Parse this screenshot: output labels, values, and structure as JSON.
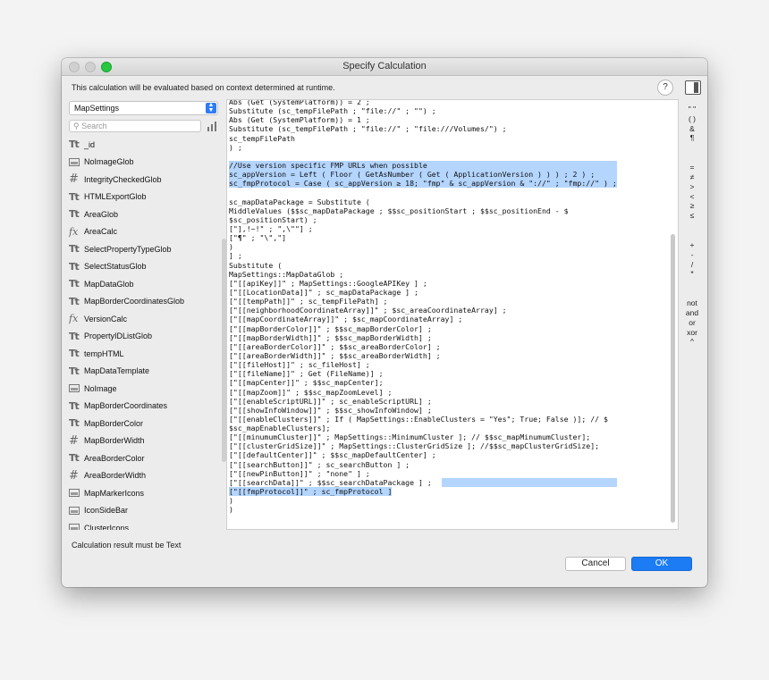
{
  "window": {
    "title": "Specify Calculation",
    "notice": "This calculation will be evaluated based on context determined at runtime.",
    "help_label": "?"
  },
  "left": {
    "table_select": "MapSettings",
    "search_placeholder": "Search",
    "fields": [
      {
        "icon": "text-icon",
        "glyph": "Tt",
        "name": "_id"
      },
      {
        "icon": "container-icon",
        "glyph": "",
        "name": "NoImageGlob"
      },
      {
        "icon": "number-icon",
        "glyph": "#",
        "name": "IntegrityCheckedGlob"
      },
      {
        "icon": "text-icon",
        "glyph": "Tt",
        "name": "HTMLExportGlob"
      },
      {
        "icon": "text-icon",
        "glyph": "Tt",
        "name": "AreaGlob"
      },
      {
        "icon": "calc-icon",
        "glyph": "fx",
        "name": "AreaCalc"
      },
      {
        "icon": "text-icon",
        "glyph": "Tt",
        "name": "SelectPropertyTypeGlob"
      },
      {
        "icon": "text-icon",
        "glyph": "Tt",
        "name": "SelectStatusGlob"
      },
      {
        "icon": "text-icon",
        "glyph": "Tt",
        "name": "MapDataGlob"
      },
      {
        "icon": "text-icon",
        "glyph": "Tt",
        "name": "MapBorderCoordinatesGlob"
      },
      {
        "icon": "calc-icon",
        "glyph": "fx",
        "name": "VersionCalc"
      },
      {
        "icon": "text-icon",
        "glyph": "Tt",
        "name": "PropertyIDListGlob"
      },
      {
        "icon": "text-icon",
        "glyph": "Tt",
        "name": "tempHTML"
      },
      {
        "icon": "text-icon",
        "glyph": "Tt",
        "name": "MapDataTemplate"
      },
      {
        "icon": "container-icon",
        "glyph": "",
        "name": "NoImage"
      },
      {
        "icon": "text-icon",
        "glyph": "Tt",
        "name": "MapBorderCoordinates"
      },
      {
        "icon": "text-icon",
        "glyph": "Tt",
        "name": "MapBorderColor"
      },
      {
        "icon": "number-icon",
        "glyph": "#",
        "name": "MapBorderWidth"
      },
      {
        "icon": "text-icon",
        "glyph": "Tt",
        "name": "AreaBorderColor"
      },
      {
        "icon": "number-icon",
        "glyph": "#",
        "name": "AreaBorderWidth"
      },
      {
        "icon": "container-icon",
        "glyph": "",
        "name": "MapMarkerIcons"
      },
      {
        "icon": "container-icon",
        "glyph": "",
        "name": "IconSideBar"
      },
      {
        "icon": "container-icon",
        "glyph": "",
        "name": "ClusterIcons"
      }
    ]
  },
  "editor": {
    "lines": [
      {
        "text": "Abs (Get (SystemPlatform)) = 2 ;",
        "hl": "none"
      },
      {
        "text": "Substitute (sc_tempFilePath ; \"file://\" ; \"\") ;",
        "hl": "none"
      },
      {
        "text": "Abs (Get (SystemPlatform)) = 1 ;",
        "hl": "none"
      },
      {
        "text": "Substitute (sc_tempFilePath ; \"file://\" ; \"file:///Volumes/\") ;",
        "hl": "none"
      },
      {
        "text": "sc_tempFilePath",
        "hl": "none"
      },
      {
        "text": ") ;",
        "hl": "none"
      },
      {
        "text": "",
        "hl": "none"
      },
      {
        "text": "//Use version specific FMP URLs when possible",
        "hl": "full"
      },
      {
        "text": "sc_appVersion = Left ( Floor ( GetAsNumber ( Get ( ApplicationVersion ) ) ) ; 2 ) ;",
        "hl": "full"
      },
      {
        "text": "sc_fmpProtocol = Case ( sc_appVersion ≥ 18; \"fmp\" & sc_appVersion & \"://\" ; \"fmp://\" ) ;",
        "hl": "full"
      },
      {
        "text": "",
        "hl": "none"
      },
      {
        "text": "sc_mapDataPackage = Substitute (",
        "hl": "none"
      },
      {
        "text": "MiddleValues ($$sc_mapDataPackage ; $$sc_positionStart ; $$sc_positionEnd - $",
        "hl": "none"
      },
      {
        "text": "$sc_positionStart) ;",
        "hl": "none"
      },
      {
        "text": "[\"],!~!\" ; \",\\\"\"] ;",
        "hl": "none"
      },
      {
        "text": "[\"¶\" ; \"\\\",\"]",
        "hl": "none"
      },
      {
        "text": ")",
        "hl": "none"
      },
      {
        "text": "] ;",
        "hl": "none"
      },
      {
        "text": "Substitute (",
        "hl": "none"
      },
      {
        "text": "MapSettings::MapDataGlob ;",
        "hl": "none"
      },
      {
        "text": "[\"[[apiKey]]\" ; MapSettings::GoogleAPIKey ] ;",
        "hl": "none"
      },
      {
        "text": "[\"[[LocationData]]\" ; sc_mapDataPackage ] ;",
        "hl": "none"
      },
      {
        "text": "[\"[[tempPath]]\" ; sc_tempFilePath] ;",
        "hl": "none"
      },
      {
        "text": "[\"[[neighborhoodCoordinateArray]]\" ; $sc_areaCoordinateArray] ;",
        "hl": "none"
      },
      {
        "text": "[\"[[mapCoordinateArray]]\" ; $sc_mapCoordinateArray] ;",
        "hl": "none"
      },
      {
        "text": "[\"[[mapBorderColor]]\" ; $$sc_mapBorderColor] ;",
        "hl": "none"
      },
      {
        "text": "[\"[[mapBorderWidth]]\" ; $$sc_mapBorderWidth] ;",
        "hl": "none"
      },
      {
        "text": "[\"[[areaBorderColor]]\" ; $$sc_areaBorderColor] ;",
        "hl": "none"
      },
      {
        "text": "[\"[[areaBorderWidth]]\" ; $$sc_areaBorderWidth] ;",
        "hl": "none"
      },
      {
        "text": "[\"[[fileHost]]\" ; sc_fileHost] ;",
        "hl": "none"
      },
      {
        "text": "[\"[[fileName]]\" ; Get (FileName)] ;",
        "hl": "none"
      },
      {
        "text": "[\"[[mapCenter]]\" ; $$sc_mapCenter];",
        "hl": "none"
      },
      {
        "text": "[\"[[mapZoom]]\" ; $$sc_mapZoomLevel] ;",
        "hl": "none"
      },
      {
        "text": "[\"[[enableScriptURL]]\" ; sc_enableScriptURL] ;",
        "hl": "none"
      },
      {
        "text": "[\"[[showInfoWindow]]\" ; $$sc_showInfoWindow] ;",
        "hl": "none"
      },
      {
        "text": "[\"[[enableClusters]]\" ; If ( MapSettings::EnableClusters = \"Yes\"; True; False )]; // $",
        "hl": "none"
      },
      {
        "text": "$sc_mapEnableClusters];",
        "hl": "none"
      },
      {
        "text": "[\"[[minumumCluster]]\" ; MapSettings::MinimumCluster ]; // $$sc_mapMinumumCluster];",
        "hl": "none"
      },
      {
        "text": "[\"[[clusterGridSize]]\" ; MapSettings::ClusterGridSize ]; //$$sc_mapClusterGridSize];",
        "hl": "none"
      },
      {
        "text": "[\"[[defaultCenter]]\" ; $$sc_mapDefaultCenter] ;",
        "hl": "none"
      },
      {
        "text": "[\"[[searchButton]]\" ; sc_searchButton ] ;",
        "hl": "none"
      },
      {
        "text": "[\"[[newPinButton]]\" ; \"none\" ] ;",
        "hl": "none"
      },
      {
        "text": "[\"[[searchData]]\" ; $$sc_searchDataPackage ] ;",
        "hl": "tail"
      },
      {
        "text": "[\"[[fmpProtocol]]\" ; sc_fmpProtocol ]",
        "hl": "part"
      },
      {
        "text": ")",
        "hl": "none"
      },
      {
        "text": ")",
        "hl": "none"
      }
    ]
  },
  "operators": [
    "\" \"",
    "( )",
    "&",
    "¶",
    "",
    "=",
    "≠",
    ">",
    "<",
    "≥",
    "≤",
    "",
    "+",
    "-",
    "/",
    "*",
    "",
    "not",
    "and",
    "or",
    "xor",
    "^"
  ],
  "footer": {
    "result_label": "Calculation result must be",
    "result_type": "Text",
    "cancel_label": "Cancel",
    "ok_label": "OK"
  }
}
